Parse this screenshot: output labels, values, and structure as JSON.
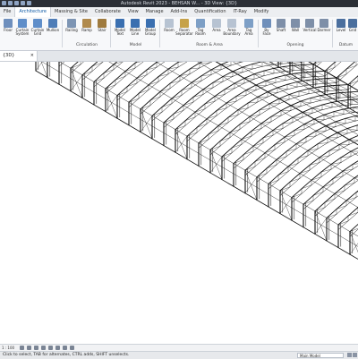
{
  "window": {
    "title": "Autodesk Revit 2023 - BEHSAN W... - 3D View: {3D}"
  },
  "ribbon_tabs": [
    "File",
    "Architecture",
    "Massing & Site",
    "Collaborate",
    "View",
    "Manage",
    "Add-Ins",
    "Quantification",
    "IT-Ray",
    "Modify"
  ],
  "ribbon_buttons": [
    {
      "label": "Floor",
      "icon": "floor-icon",
      "color": "#6e8fbd"
    },
    {
      "label": "Curtain\nSystem",
      "icon": "curtain-system-icon",
      "color": "#5f8ec9"
    },
    {
      "label": "Curtain\nGrid",
      "icon": "curtain-grid-icon",
      "color": "#5f8ec9"
    },
    {
      "label": "Mullion",
      "icon": "mullion-icon",
      "color": "#4f7db7"
    },
    {
      "label": "Railing",
      "icon": "railing-icon",
      "color": "#7d95b4"
    },
    {
      "label": "Ramp",
      "icon": "ramp-icon",
      "color": "#b08a4d"
    },
    {
      "label": "Stair",
      "icon": "stair-icon",
      "color": "#9f7b3f"
    },
    {
      "label": "Model\nText",
      "icon": "model-text-icon",
      "color": "#3a6fb0"
    },
    {
      "label": "Model\nLine",
      "icon": "model-line-icon",
      "color": "#3a6fb0"
    },
    {
      "label": "Model\nGroup",
      "icon": "model-group-icon",
      "color": "#3a6fb0"
    },
    {
      "label": "Room",
      "icon": "room-icon",
      "color": "#b7c3d2"
    },
    {
      "label": "Room\nSeparator",
      "icon": "room-separator-icon",
      "color": "#c6a24a"
    },
    {
      "label": "Tag\nRoom",
      "icon": "tag-room-icon",
      "color": "#7d9fc6"
    },
    {
      "label": "Area",
      "icon": "area-icon",
      "color": "#b7c3d2"
    },
    {
      "label": "Area\nBoundary",
      "icon": "area-boundary-icon",
      "color": "#b7c3d2"
    },
    {
      "label": "Tag\nArea",
      "icon": "tag-area-icon",
      "color": "#7d9fc6"
    },
    {
      "label": "By\nFace",
      "icon": "by-face-icon",
      "color": "#6f8fba"
    },
    {
      "label": "Shaft",
      "icon": "shaft-icon",
      "color": "#7e8fa8"
    },
    {
      "label": "Wall",
      "icon": "wall-opening-icon",
      "color": "#7e8fa8"
    },
    {
      "label": "Vertical",
      "icon": "vertical-opening-icon",
      "color": "#7e8fa8"
    },
    {
      "label": "Dormer",
      "icon": "dormer-icon",
      "color": "#7e8fa8"
    },
    {
      "label": "Level",
      "icon": "level-icon",
      "color": "#4b6f9e"
    },
    {
      "label": "Grid",
      "icon": "grid-icon",
      "color": "#4b6f9e"
    }
  ],
  "ribbon_panels": [
    "Circulation",
    "Model",
    "Room & Area",
    "Opening",
    "Datum"
  ],
  "document_tab": {
    "label": "{3D}",
    "close": "×"
  },
  "view_controls": {
    "scale": "1 : 100"
  },
  "status": {
    "left": "Click to select, TAB for alternates, CTRL adds, SHIFT unselects.",
    "model": "Main Model"
  }
}
